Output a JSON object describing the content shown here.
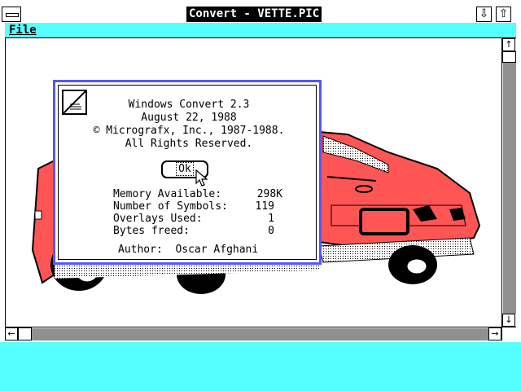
{
  "window": {
    "title": "Convert - VETTE.PIC",
    "menu": [
      {
        "label": "File"
      }
    ]
  },
  "dialog": {
    "line1": "Windows Convert 2.3",
    "line2": "August 22, 1988",
    "line3": "© Micrografx, Inc., 1987-1988.",
    "line4": "All Rights Reserved.",
    "ok_label": "Ok",
    "stats": [
      {
        "label": "Memory Available:",
        "value": "298K"
      },
      {
        "label": "Number of Symbols:",
        "value": "119"
      },
      {
        "label": "Overlays Used:",
        "value": "1"
      },
      {
        "label": "Bytes freed:",
        "value": "0"
      }
    ],
    "author_label": "Author:",
    "author_name": "Oscar Afghani"
  },
  "colors": {
    "desktop": "#55ffff",
    "menubar": "#55ffff",
    "dialog_border": "#5555ff",
    "car_body": "#ff5555",
    "title_active": "#000000"
  },
  "icons": {
    "system_menu": "system-menu-icon",
    "minimize": "arrow-down-icon",
    "maximize": "arrow-up-icon",
    "app": "convert-app-icon",
    "picture": "corvette-picture"
  }
}
